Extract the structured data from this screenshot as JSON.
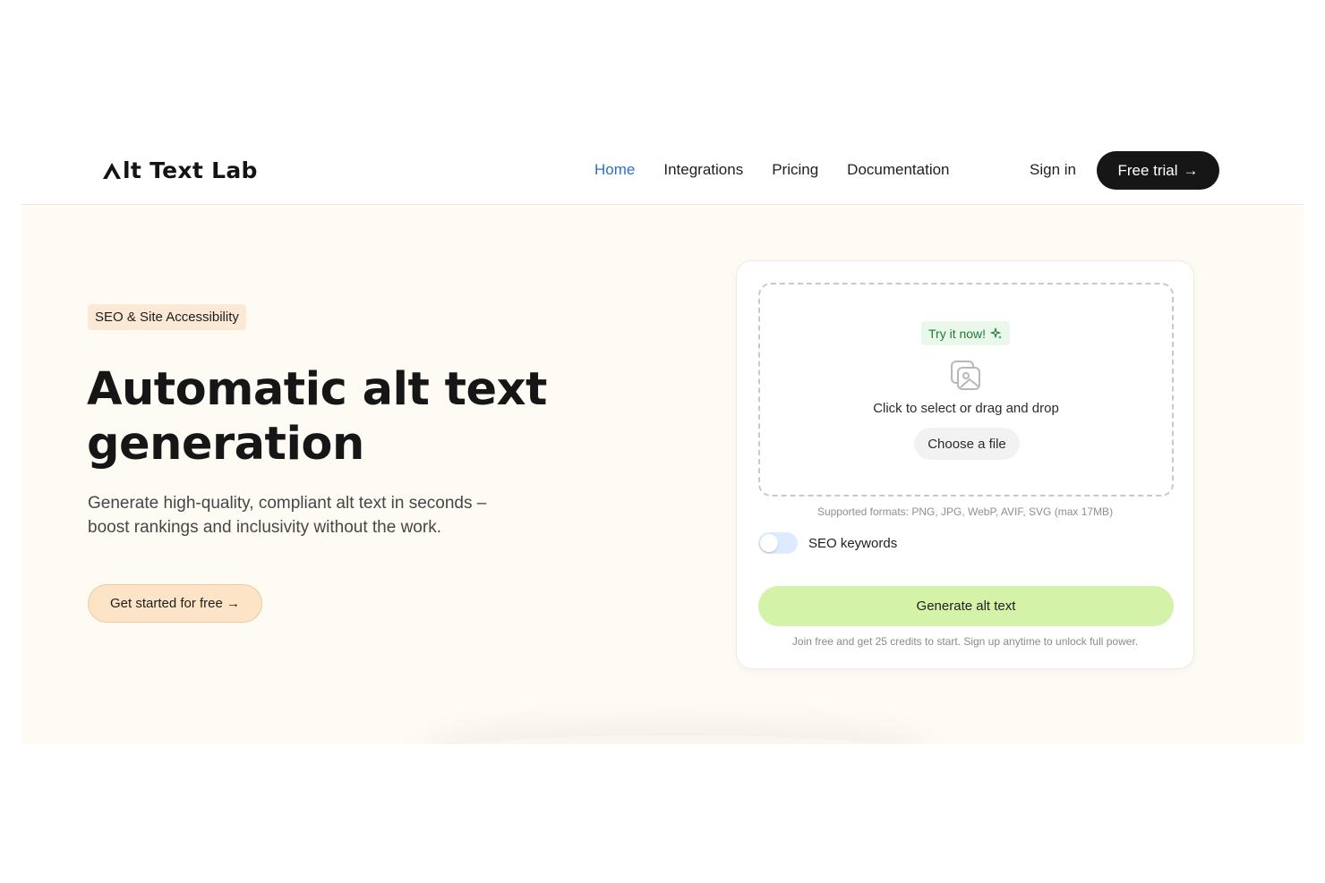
{
  "header": {
    "logo_text": "lt Text Lab",
    "nav": [
      {
        "label": "Home",
        "active": true
      },
      {
        "label": "Integrations",
        "active": false
      },
      {
        "label": "Pricing",
        "active": false
      },
      {
        "label": "Documentation",
        "active": false
      }
    ],
    "sign_in": "Sign in",
    "free_trial": "Free trial",
    "arrow": "→"
  },
  "hero": {
    "tag": "SEO & Site Accessibility",
    "headline_line1": "Automatic alt text",
    "headline_line2": "generation",
    "subline": "Generate high-quality, compliant alt text in seconds – boost rankings and inclusivity without the work.",
    "cta": "Get started for free →"
  },
  "upload": {
    "try_badge": "Try it now!",
    "drop_text": "Click to select or drag and drop",
    "choose_file": "Choose a file",
    "formats": "Supported formats: PNG, JPG, WebP, AVIF, SVG (max 17MB)",
    "seo_toggle_label": "SEO keywords",
    "seo_toggle_on": false,
    "generate": "Generate alt text",
    "join_note": "Join free and get 25 credits to start. Sign up anytime to unlock full power."
  },
  "colors": {
    "nav_active": "#2b6fd6",
    "hero_bg": "#fefaf4",
    "cta_bg": "#fde4c6",
    "generate_bg": "#d4f2a8",
    "try_badge_text": "#1f7a34",
    "dark_button": "#161616"
  },
  "icons": {
    "logo": "triangle-a-logo-icon",
    "sparkle": "sparkle-icon",
    "upload_image": "image-stack-icon",
    "arrow": "arrow-right-icon"
  }
}
